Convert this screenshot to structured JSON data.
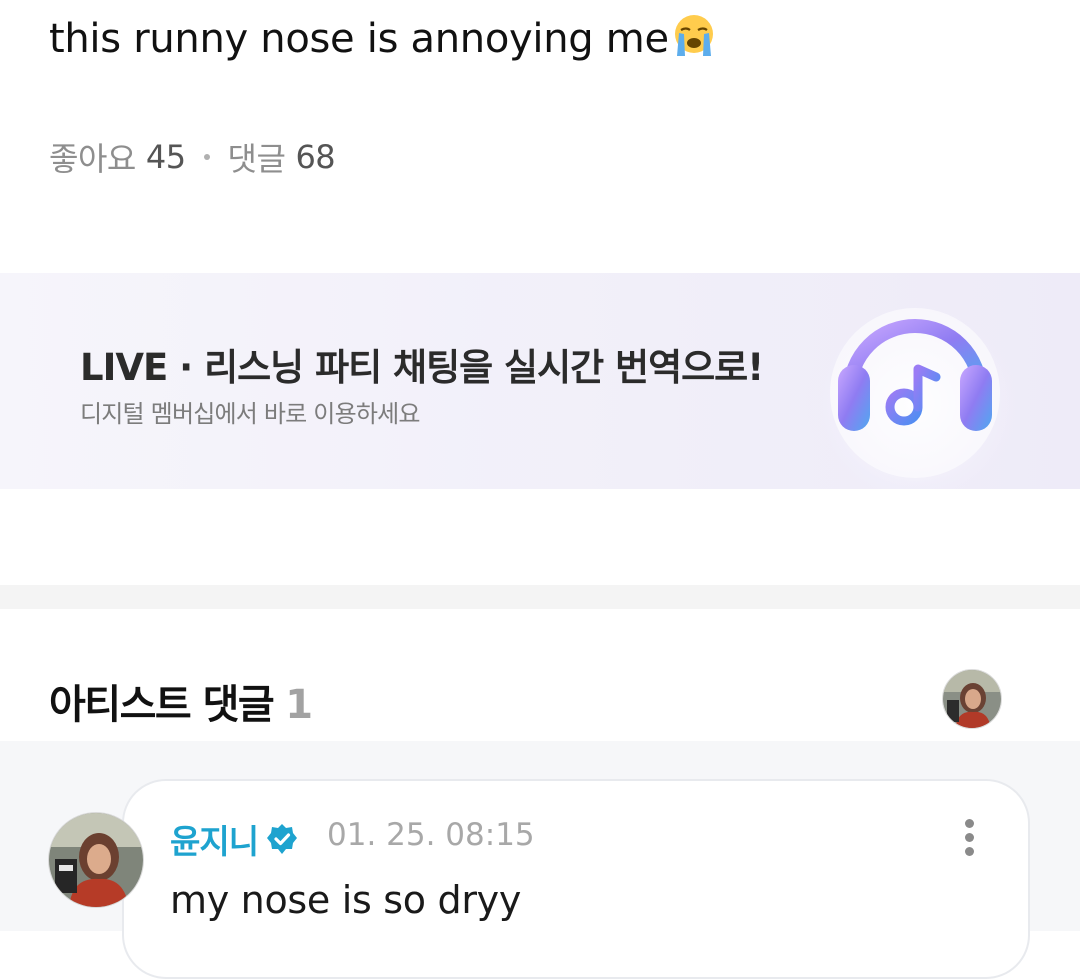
{
  "post": {
    "text": "this runny nose is annoying me",
    "emoji_icon": "loudly-crying-face-icon",
    "likes_label": "좋아요",
    "likes_count": "45",
    "comments_label": "댓글",
    "comments_count": "68"
  },
  "promo": {
    "title": "LIVE · 리스닝 파티 채팅을 실시간 번역으로!",
    "subtitle": "디지털 멤버십에서 바로 이용하세요",
    "icon": "headphones-music-icon"
  },
  "artist_comments": {
    "heading": "아티스트 댓글",
    "count": "1",
    "comments": [
      {
        "author": "윤지니",
        "verified_icon": "verified-badge-icon",
        "timestamp": "01. 25. 08:15",
        "text": "my nose is so dryy"
      }
    ]
  },
  "colors": {
    "accent": "#1ea3cf",
    "muted_text": "#8e8e8e",
    "banner_bg": "#f3f1fa"
  }
}
